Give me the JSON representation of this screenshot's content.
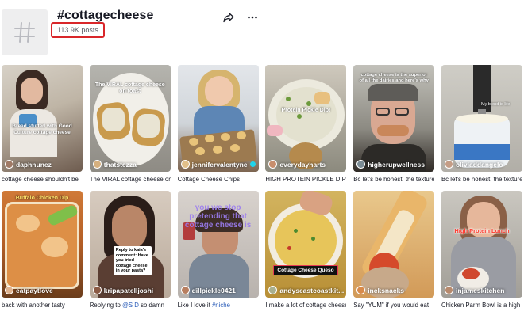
{
  "header": {
    "title": "#cottagecheese",
    "post_count": "113.9K posts"
  },
  "cards": [
    {
      "author": "daphnunez",
      "caption": "cottage cheese shouldn't be",
      "overlay": "Bread stuffed with Good Culture cottage cheese",
      "colors": [
        "#c9c1b6",
        "#6c5b4f"
      ]
    },
    {
      "author": "thatstezza",
      "caption": "The VIRAL cottage cheese on",
      "overlay": "The VIRAL cottage cheese on toast",
      "colors": [
        "#a6a6a2",
        "#53483b"
      ]
    },
    {
      "author": "jennifervalentyne",
      "caption": "Cottage Cheese Chips",
      "overlay": "",
      "verified": true,
      "colors": [
        "#d5dbe2",
        "#8b6b4a"
      ]
    },
    {
      "author": "everydayharts",
      "caption": "HIGH PROTEIN PICKLE DIP",
      "overlay": "Protein Pickle Dip!",
      "colors": [
        "#d9d5c9",
        "#5f7d3a"
      ]
    },
    {
      "author": "higherupwellness",
      "caption": "Bc let's be honest, the texture",
      "overlay": "cottage cheese is the superior of all the dairies and here's why",
      "colors": [
        "#b8b7b0",
        "#3d3830"
      ]
    },
    {
      "author": "oliviaddangelo",
      "caption": "Bc let's be honest, the texture",
      "overlay": "My blend is life",
      "colors": [
        "#c6c4bd",
        "#4a4a4a"
      ]
    },
    {
      "author": "eatpaytlove",
      "caption": "back with another tasty",
      "overlay": "Buffalo Chicken Dip",
      "colors": [
        "#c56a2c",
        "#6b4a20"
      ]
    },
    {
      "author": "kripapatelljoshi",
      "caption": "Replying to @S D so damn",
      "overlay": "",
      "colors": [
        "#d2c5b8",
        "#4d3b32"
      ]
    },
    {
      "author": "dillpickle0421",
      "caption": "Like I love it #niche",
      "overlay": "you we stop pretending that cottage cheese is",
      "colors": [
        "#cfc9c4",
        "#5c6b7a"
      ]
    },
    {
      "author": "andyseastcoastkit...",
      "caption": "I make a lot of cottage cheese",
      "overlay": "Cottage Cheese Queso",
      "colors": [
        "#c8a43c",
        "#6b5a2a"
      ]
    },
    {
      "author": "incksnacks",
      "caption": "Say \"YUM\" if you would eat",
      "overlay": "",
      "colors": [
        "#e6c07c",
        "#b44a2a"
      ]
    },
    {
      "author": "injameskitchen",
      "caption": "Chicken Parm Bowl is a high",
      "overlay": "High Protein Lunch",
      "colors": [
        "#bcbab4",
        "#6b5a4f"
      ]
    }
  ],
  "reply_tag": "Reply to kaia's comment: Have you tried cottage cheese in your pasta?",
  "reply_mention": "@S D",
  "hashtag_niche": "#niche"
}
